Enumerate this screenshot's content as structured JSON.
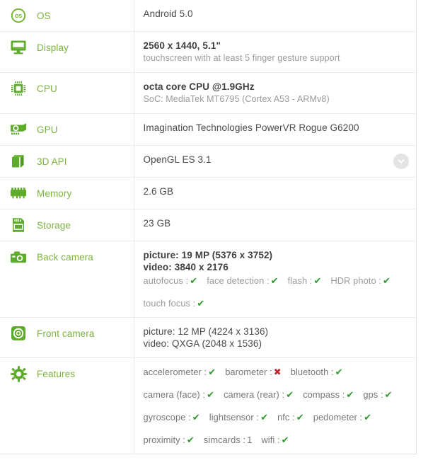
{
  "rows": [
    {
      "key": "os",
      "icon": "os-badge-icon",
      "label": "OS",
      "primary": "Android 5.0",
      "secondary": "",
      "bold": false
    },
    {
      "key": "display",
      "icon": "monitor-icon",
      "label": "Display",
      "primary": "2560 x 1440, 5.1\"",
      "secondary": "touchscreen with at least 5 finger gesture support",
      "bold": true
    },
    {
      "key": "cpu",
      "icon": "cpu-chip-icon",
      "label": "CPU",
      "primary": "octa core CPU @1.9GHz",
      "secondary": "SoC: MediaTek MT6795 (Cortex A53 - ARMv8)",
      "bold": true
    },
    {
      "key": "gpu",
      "icon": "graphics-card-icon",
      "label": "GPU",
      "primary": "Imagination Technologies PowerVR Rogue G6200",
      "secondary": "",
      "bold": false
    },
    {
      "key": "3d-api",
      "icon": "cube-icon",
      "label": "3D API",
      "primary": "OpenGL ES 3.1",
      "secondary": "",
      "bold": false,
      "expandable": true
    },
    {
      "key": "memory",
      "icon": "memory-module-icon",
      "label": "Memory",
      "primary": "2.6 GB",
      "secondary": "",
      "bold": false
    },
    {
      "key": "storage",
      "icon": "storage-card-icon",
      "label": "Storage",
      "primary": "23 GB",
      "secondary": "",
      "bold": false
    }
  ],
  "back_camera": {
    "key": "back-camera",
    "icon": "camera-icon",
    "label": "Back camera",
    "picture": "picture: 19 MP (5376 x 3752)",
    "video": "video: 3840 x 2176",
    "attrs_line1": [
      {
        "name": "autofocus :",
        "mark": "yes"
      },
      {
        "name": "face detection :",
        "mark": "yes"
      },
      {
        "name": "flash :",
        "mark": "yes"
      },
      {
        "name": "HDR photo :",
        "mark": "yes"
      }
    ],
    "attrs_line2": [
      {
        "name": "touch focus :",
        "mark": "yes"
      }
    ]
  },
  "front_camera": {
    "key": "front-camera",
    "icon": "front-camera-icon",
    "label": "Front camera",
    "picture": "picture: 12 MP (4224 x 3136)",
    "video": "video: QXGA (2048 x 1536)"
  },
  "features": {
    "key": "features",
    "icon": "gear-icon",
    "label": "Features",
    "lines": [
      [
        {
          "name": "accelerometer :",
          "mark": "yes"
        },
        {
          "name": "barometer :",
          "mark": "no"
        },
        {
          "name": "bluetooth :",
          "mark": "yes"
        }
      ],
      [
        {
          "name": "camera (face) :",
          "mark": "yes"
        },
        {
          "name": "camera (rear) :",
          "mark": "yes"
        },
        {
          "name": "compass :",
          "mark": "yes"
        },
        {
          "name": "gps :",
          "mark": "yes"
        }
      ],
      [
        {
          "name": "gyroscope :",
          "mark": "yes"
        },
        {
          "name": "lightsensor :",
          "mark": "yes"
        },
        {
          "name": "nfc :",
          "mark": "yes"
        },
        {
          "name": "pedometer :",
          "mark": "yes"
        }
      ],
      [
        {
          "name": "proximity :",
          "mark": "yes"
        },
        {
          "name": "simcards :",
          "value": "1"
        },
        {
          "name": "wifi :",
          "mark": "yes"
        }
      ]
    ]
  },
  "marks": {
    "yes": "✔",
    "no": "✖"
  },
  "colors": {
    "label_green": "#7cb342",
    "icon_green": "#5cab2a",
    "value_dark": "#4a4a4a",
    "value_muted": "#9b9b9b",
    "check_green": "#2e9b2e",
    "cross_red": "#c0272d",
    "border": "#ececed"
  }
}
